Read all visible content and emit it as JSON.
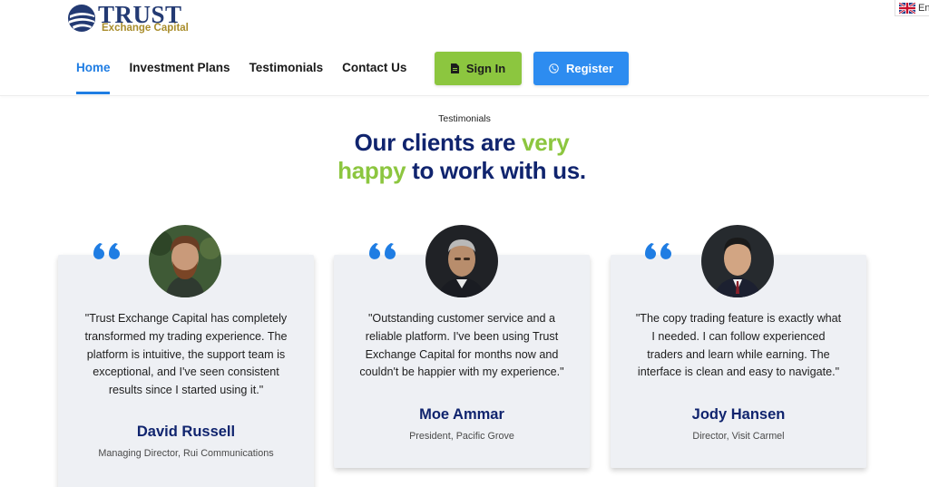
{
  "brand": {
    "name": "TRUST",
    "tagline": "Exchange Capital"
  },
  "language": {
    "label": "En",
    "flag_icon": "uk-flag-icon"
  },
  "nav": {
    "items": [
      {
        "label": "Home",
        "active": true
      },
      {
        "label": "Investment Plans",
        "active": false
      },
      {
        "label": "Testimonials",
        "active": false
      },
      {
        "label": "Contact Us",
        "active": false
      }
    ],
    "signin_label": "Sign In",
    "register_label": "Register"
  },
  "section": {
    "kicker": "Testimonials",
    "headline_part1": "Our clients are ",
    "headline_green1": "very",
    "headline_green2": "happy",
    "headline_part2": " to work with us."
  },
  "testimonials": [
    {
      "quote": "\"Trust Exchange Capital has completely transformed my trading experience. The platform is intuitive, the support team is exceptional, and I've seen consistent results since I started using it.\"",
      "name": "David Russell",
      "role": "Managing Director, Rui Communications"
    },
    {
      "quote": "\"Outstanding customer service and a reliable platform. I've been using Trust Exchange Capital for months now and couldn't be happier with my experience.\"",
      "name": "Moe Ammar",
      "role": "President, Pacific Grove"
    },
    {
      "quote": "\"The copy trading feature is exactly what I needed. I can follow experienced traders and learn while earning. The interface is clean and easy to navigate.\"",
      "name": "Jody Hansen",
      "role": "Director, Visit Carmel"
    }
  ],
  "colors": {
    "navy": "#10246e",
    "green": "#8cc63f",
    "blue": "#2d8cf0",
    "card_bg": "#eef0f4"
  }
}
